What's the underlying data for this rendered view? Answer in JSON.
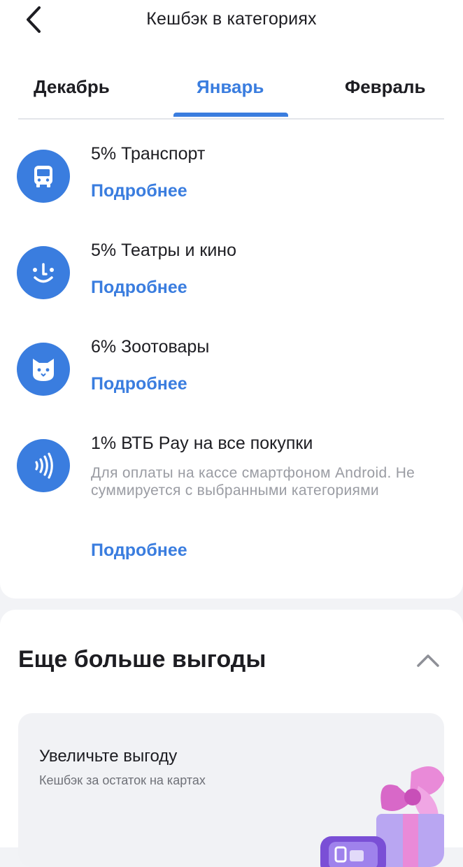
{
  "header": {
    "title": "Кешбэк в категориях",
    "back_icon": "chevron-left-icon"
  },
  "tabs": [
    {
      "label": "Декабрь",
      "active": false
    },
    {
      "label": "Январь",
      "active": true
    },
    {
      "label": "Февраль",
      "active": false
    }
  ],
  "categories": [
    {
      "title": "5% Транспорт",
      "icon": "bus-icon",
      "link": "Подробнее"
    },
    {
      "title": "5% Театры и кино",
      "icon": "smile-icon",
      "link": "Подробнее"
    },
    {
      "title": "6% Зоотовары",
      "icon": "cat-icon",
      "link": "Подробнее"
    },
    {
      "title": "1% ВТБ Pay на все покупки",
      "icon": "contactless-icon",
      "description": "Для оплаты на кассе смартфоном Android. Не суммируется с выбранными категориями",
      "link": "Подробнее"
    }
  ],
  "more": {
    "title": "Еще больше выгоды",
    "collapse_icon": "chevron-up-icon",
    "promo": {
      "title": "Увеличьте выгоду",
      "subtitle": "Кешбэк за остаток на картах",
      "art_icon": "gift-bow-icon"
    }
  },
  "colors": {
    "accent": "#3a7ddf",
    "text": "#1d1d22",
    "muted": "#9a9ca3",
    "background": "#f2f3f6"
  }
}
